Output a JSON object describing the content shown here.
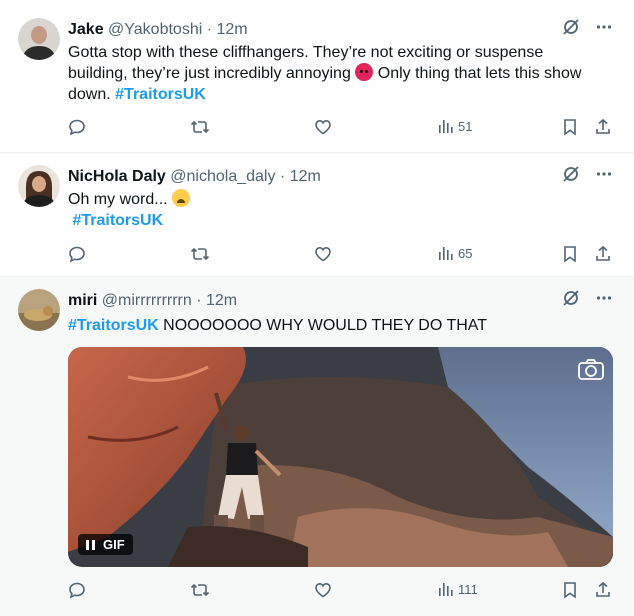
{
  "tweets": [
    {
      "name": "Jake",
      "handle": "@Yakobtoshi",
      "time": "12m",
      "text_parts": [
        "Gotta stop with these cliffhangers. They’re not exciting or suspense",
        "building, they’re just incredibly annoying",
        "Only thing that lets this show",
        "down."
      ],
      "hashtag": "#TraitorsUK",
      "views": "51"
    },
    {
      "name": "NicHola Daly",
      "handle": "@nichola_daly",
      "time": "12m",
      "text": "Oh my word...",
      "hashtag": "#TraitorsUK",
      "views": "65"
    },
    {
      "name": "miri",
      "handle": "@mirrrrrrrrrn",
      "time": "12m",
      "hashtag": "#TraitorsUK",
      "text": "NOOOOOOO WHY WOULD THEY DO THAT",
      "gif_label": "GIF",
      "views": "111"
    }
  ],
  "separator": " · ",
  "icons": {
    "reply": "reply-icon",
    "retweet": "retweet-icon",
    "like": "heart-icon",
    "views": "views-icon",
    "bookmark": "bookmark-icon",
    "share": "share-icon",
    "grok": "grok-icon",
    "more": "more-icon",
    "camera": "camera-icon"
  },
  "colors": {
    "hashtag": "#1d9bf0",
    "secondary_text": "#536471",
    "highlight_bg": "#f7f9f9"
  }
}
